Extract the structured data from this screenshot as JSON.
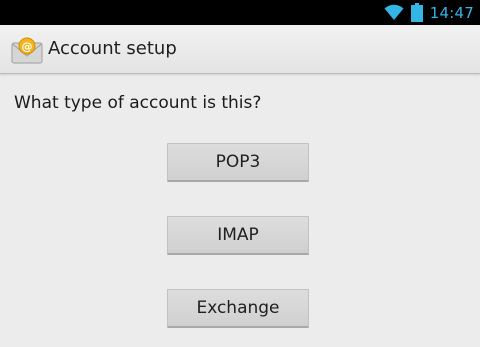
{
  "status_bar": {
    "time": "14:47",
    "icons": [
      "wifi-icon",
      "battery-icon"
    ],
    "accent_color": "#33b5e5"
  },
  "action_bar": {
    "app_icon": "email-app-icon",
    "title": "Account setup"
  },
  "main": {
    "prompt": "What type of account is this?",
    "buttons": [
      {
        "label": "POP3"
      },
      {
        "label": "IMAP"
      },
      {
        "label": "Exchange"
      }
    ]
  }
}
